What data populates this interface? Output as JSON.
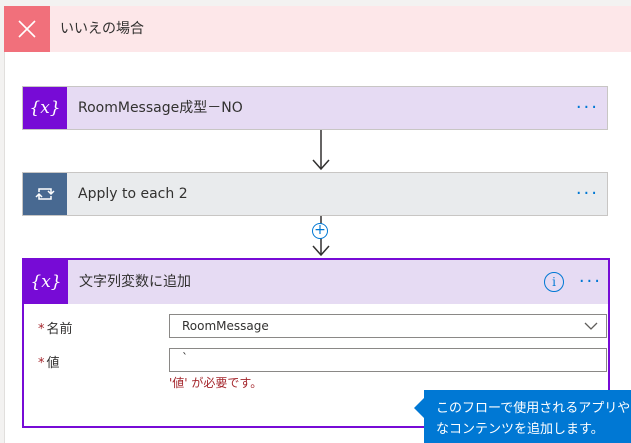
{
  "branch": {
    "title": "いいえの場合",
    "close_icon": "close-icon"
  },
  "steps": [
    {
      "title": "RoomMessage成型－NO",
      "icon": "variable-icon",
      "icon_glyph": "{x}",
      "more": "···"
    },
    {
      "title": "Apply to each 2",
      "icon": "loop-icon",
      "more": "···"
    }
  ],
  "add_step": {
    "glyph": "+"
  },
  "append_action": {
    "title": "文字列変数に追加",
    "icon_glyph": "{x}",
    "info_glyph": "i",
    "more": "···",
    "fields": {
      "name": {
        "required_mark": "*",
        "label": "名前",
        "value": "RoomMessage"
      },
      "value": {
        "required_mark": "*",
        "label": "値",
        "value": "`",
        "error": "'値' が必要です。"
      }
    }
  },
  "tooltip": {
    "line1": "このフローで使用されるアプリや",
    "line2": "なコンテンツを追加します。"
  },
  "colors": {
    "accent": "#0078d4",
    "variable": "#770bd6",
    "loop": "#486991",
    "error": "#a4262c",
    "no_branch": "#f1707b"
  }
}
